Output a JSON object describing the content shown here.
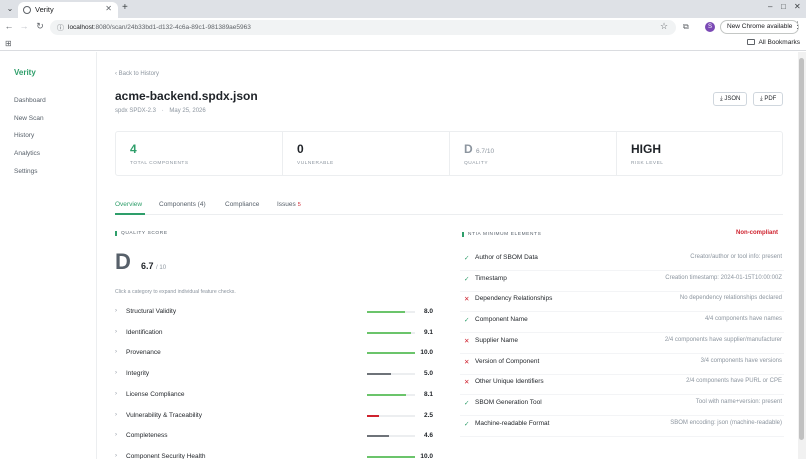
{
  "browser": {
    "tab_title": "Verity",
    "url_host": "localhost",
    "url_rest": ":8080/scan/24b33bd1-d132-4c6a-89c1-981389ae5963",
    "chrome_available": "New Chrome available",
    "profile_initial": "S",
    "all_bookmarks": "All Bookmarks"
  },
  "sidebar": {
    "brand": "Verity",
    "items": [
      {
        "label": "Dashboard"
      },
      {
        "label": "New Scan"
      },
      {
        "label": "History"
      },
      {
        "label": "Analytics"
      },
      {
        "label": "Settings"
      }
    ]
  },
  "header": {
    "back": "Back to History",
    "title": "acme-backend.spdx.json",
    "format": "spdx SPDX-2.3",
    "separator": "·",
    "date": "May 25, 2026",
    "json_btn": "JSON",
    "pdf_btn": "PDF"
  },
  "stats": [
    {
      "value": "4",
      "sub": "",
      "label": "TOTAL COMPONENTS"
    },
    {
      "value": "0",
      "sub": "",
      "label": "VULNERABLE"
    },
    {
      "value": "D",
      "sub": "6.7/10",
      "label": "QUALITY"
    },
    {
      "value": "HIGH",
      "sub": "",
      "label": "RISK LEVEL"
    }
  ],
  "tabs": {
    "overview": "Overview",
    "components": "Components (4)",
    "compliance": "Compliance",
    "issues": "Issues",
    "issues_count": "5"
  },
  "quality": {
    "heading": "QUALITY SCORE",
    "grade": "D",
    "score": "6.7",
    "out_of": "/ 10",
    "hint": "Click a category to expand individual feature checks.",
    "categories": [
      {
        "label": "Structural Validity",
        "score": "8.0",
        "fraction": 0.8,
        "color": "#6bc46b"
      },
      {
        "label": "Identification",
        "score": "9.1",
        "fraction": 0.91,
        "color": "#6bc46b"
      },
      {
        "label": "Provenance",
        "score": "10.0",
        "fraction": 1.0,
        "color": "#6bc46b"
      },
      {
        "label": "Integrity",
        "score": "5.0",
        "fraction": 0.5,
        "color": "#6e7379"
      },
      {
        "label": "License Compliance",
        "score": "8.1",
        "fraction": 0.81,
        "color": "#6bc46b"
      },
      {
        "label": "Vulnerability & Traceability",
        "score": "2.5",
        "fraction": 0.25,
        "color": "#cf222e"
      },
      {
        "label": "Completeness",
        "score": "4.6",
        "fraction": 0.46,
        "color": "#6e7379"
      },
      {
        "label": "Component Security Health",
        "score": "10.0",
        "fraction": 1.0,
        "color": "#6bc46b"
      }
    ]
  },
  "ntia": {
    "heading": "NTIA MINIMUM ELEMENTS",
    "status": "Non-compliant",
    "items": [
      {
        "pass": true,
        "mark": "✓",
        "label": "Author of SBOM Data",
        "detail": "Creator/author or tool info: present"
      },
      {
        "pass": true,
        "mark": "✓",
        "label": "Timestamp",
        "detail": "Creation timestamp: 2024-01-15T10:00:00Z"
      },
      {
        "pass": false,
        "mark": "✕",
        "label": "Dependency Relationships",
        "detail": "No dependency relationships declared"
      },
      {
        "pass": true,
        "mark": "✓",
        "label": "Component Name",
        "detail": "4/4 components have names"
      },
      {
        "pass": false,
        "mark": "✕",
        "label": "Supplier Name",
        "detail": "2/4 components have supplier/manufacturer"
      },
      {
        "pass": false,
        "mark": "✕",
        "label": "Version of Component",
        "detail": "3/4 components have versions"
      },
      {
        "pass": false,
        "mark": "✕",
        "label": "Other Unique Identifiers",
        "detail": "2/4 components have PURL or CPE"
      },
      {
        "pass": true,
        "mark": "✓",
        "label": "SBOM Generation Tool",
        "detail": "Tool with name+version: present"
      },
      {
        "pass": true,
        "mark": "✓",
        "label": "Machine-readable Format",
        "detail": "SBOM encoding: json (machine-readable)"
      }
    ]
  },
  "icons": {
    "tab_menu": "chevron-down-icon",
    "favicon": "globe-icon",
    "close": "close-icon",
    "new_tab": "plus-icon",
    "back": "arrow-left-icon",
    "forward": "arrow-right-icon",
    "reload": "reload-icon",
    "site_info": "site-info-icon",
    "bookmark": "star-icon",
    "extensions": "extensions-icon",
    "menu": "kebab-icon",
    "apps": "apps-icon",
    "folder": "folder-icon",
    "download": "download-icon",
    "chevron": "chevron-right-icon"
  },
  "colors": {
    "accent": "#2e9e6a",
    "danger": "#cf222e",
    "muted": "#8c959f"
  }
}
